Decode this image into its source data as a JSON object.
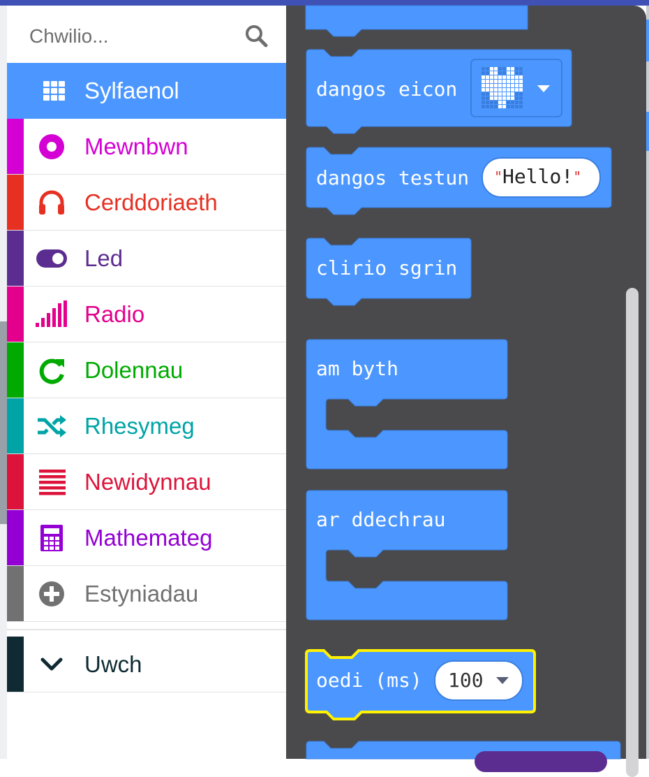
{
  "search": {
    "placeholder": "Chwilio..."
  },
  "categories": [
    {
      "label": "Sylfaenol",
      "icon": "grid-icon",
      "color": "#1e90ff"
    },
    {
      "label": "Mewnbwn",
      "icon": "radio-button-icon",
      "color": "#d400d4"
    },
    {
      "label": "Cerddoriaeth",
      "icon": "headphones-icon",
      "color": "#e63022"
    },
    {
      "label": "Led",
      "icon": "toggle-icon",
      "color": "#5c2d91"
    },
    {
      "label": "Radio",
      "icon": "signal-bars-icon",
      "color": "#e3008c"
    },
    {
      "label": "Dolennau",
      "icon": "refresh-icon",
      "color": "#00aa00"
    },
    {
      "label": "Rhesymeg",
      "icon": "shuffle-icon",
      "color": "#00a4a6"
    },
    {
      "label": "Newidynnau",
      "icon": "list-lines-icon",
      "color": "#dc143c"
    },
    {
      "label": "Mathemateg",
      "icon": "calculator-icon",
      "color": "#9400d3"
    },
    {
      "label": "Estyniadau",
      "icon": "plus-circle-icon",
      "color": "#717171"
    }
  ],
  "advanced": {
    "label": "Uwch",
    "icon": "chevron-down-icon",
    "color": "#0f2a33"
  },
  "blocks": {
    "show_icon": "dangos eicon",
    "show_string": "dangos testun",
    "show_string_value": "Hello!",
    "clear_screen": "clirio sgrin",
    "forever": "am byth",
    "on_start": "ar ddechrau",
    "pause": "oedi (ms)",
    "pause_value": "100"
  },
  "colors": {
    "block_blue": "#4c97ff",
    "flyout_bg": "#4a4a4c",
    "highlight": "#fff200"
  }
}
